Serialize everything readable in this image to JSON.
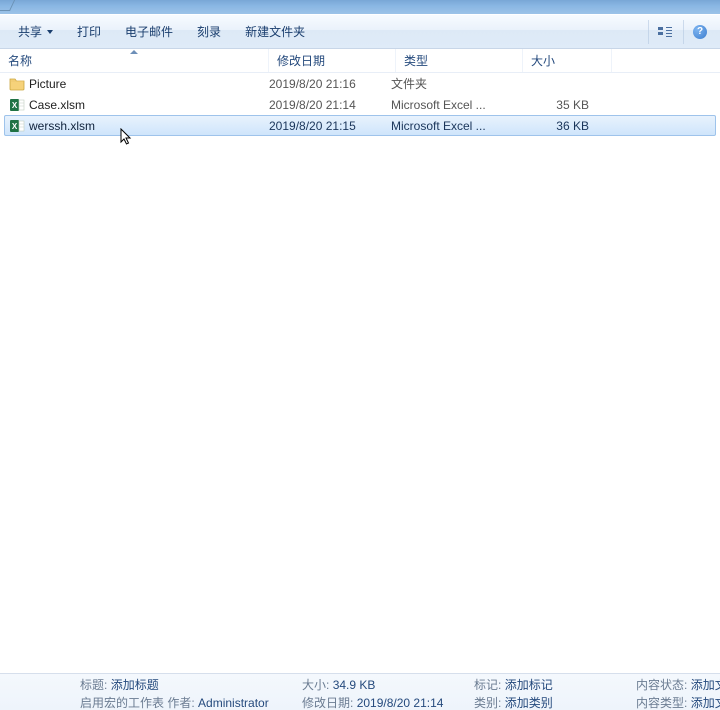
{
  "toolbar": {
    "share": "共享",
    "print": "打印",
    "email": "电子邮件",
    "burn": "刻录",
    "newfolder": "新建文件夹"
  },
  "columns": {
    "name": "名称",
    "date": "修改日期",
    "type": "类型",
    "size": "大小"
  },
  "files": [
    {
      "name": "Picture",
      "date": "2019/8/20 21:16",
      "type": "文件夹",
      "size": "",
      "icon": "folder"
    },
    {
      "name": "Case.xlsm",
      "date": "2019/8/20 21:14",
      "type": "Microsoft Excel ...",
      "size": "35 KB",
      "icon": "excel"
    },
    {
      "name": "werssh.xlsm",
      "date": "2019/8/20 21:15",
      "type": "Microsoft Excel ...",
      "size": "36 KB",
      "icon": "excel",
      "selected": true
    }
  ],
  "status": {
    "title_label": "标题:",
    "title_value": "添加标题",
    "line2a_label": "启用宏的工作表  作者:",
    "line2a_value": "Administrator",
    "size_label": "大小:",
    "size_value": "34.9 KB",
    "date_label": "修改日期:",
    "date_value": "2019/8/20 21:14",
    "tag_label": "标记:",
    "tag_value": "添加标记",
    "cat_label": "类别:",
    "cat_value": "添加类别",
    "cstat_label": "内容状态:",
    "cstat_value": "添加文本",
    "ctype_label": "内容类型:",
    "ctype_value": "添加文本"
  }
}
